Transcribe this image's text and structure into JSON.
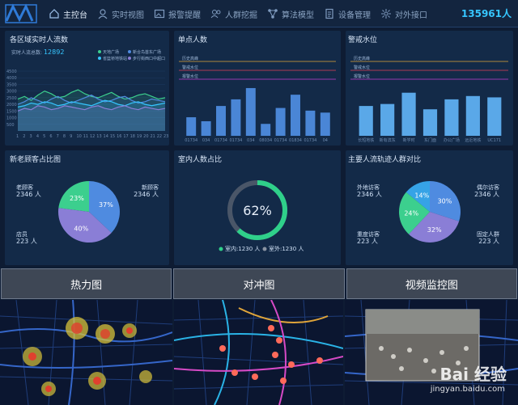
{
  "header": {
    "total_count": "135961人",
    "nav": [
      {
        "label": "主控台",
        "icon": "home-icon"
      },
      {
        "label": "实时视图",
        "icon": "user-icon"
      },
      {
        "label": "报警提醒",
        "icon": "image-icon"
      },
      {
        "label": "人群挖掘",
        "icon": "people-icon"
      },
      {
        "label": "算法模型",
        "icon": "network-icon"
      },
      {
        "label": "设备管理",
        "icon": "document-icon"
      },
      {
        "label": "对外接口",
        "icon": "api-icon"
      }
    ]
  },
  "panels": {
    "flow": {
      "title": "各区域实时人流数",
      "total_label": "实时人流总数:",
      "total_value": "12892",
      "legend": [
        "天地广场",
        "新合鸟首东广场",
        "省篮桥地铁站",
        "步行街西口中超口"
      ]
    },
    "single": {
      "title": "单点人数",
      "lines": [
        "历史高峰",
        "警戒水位",
        "报警水位"
      ]
    },
    "warn": {
      "title": "警戒水位",
      "lines": [
        "历史高峰",
        "警戒水位",
        "报警水位"
      ]
    },
    "newold": {
      "title": "新老顾客占比图",
      "labels": [
        {
          "name": "老顾客",
          "value": "2346 人"
        },
        {
          "name": "新顾客",
          "value": "2346 人"
        },
        {
          "name": "店员",
          "value": "223 人"
        }
      ]
    },
    "indoor": {
      "title": "室内人数占比",
      "percent": "62%",
      "legend": [
        "室内:1230 人",
        "室外:1230 人"
      ]
    },
    "trace": {
      "title": "主要人流轨迹人群对比",
      "labels": [
        {
          "name": "外地访客",
          "value": "2346 人"
        },
        {
          "name": "偶尔访客",
          "value": "2346 人"
        },
        {
          "name": "重度访客",
          "value": "223 人"
        },
        {
          "name": "固定人群",
          "value": "223 人"
        }
      ]
    }
  },
  "tabs": [
    "热力图",
    "对冲图",
    "视频监控图"
  ],
  "watermark": {
    "brand": "Bai 经验",
    "url": "jingyan.baidu.com"
  },
  "colors": {
    "accent": "#36c6ff",
    "bar": "#4a86d6",
    "green": "#3ccf8e",
    "purple": "#8a7ed6",
    "blue": "#4f8be0"
  },
  "chart_data": [
    {
      "type": "line",
      "title": "各区域实时人流数",
      "x": [
        1,
        2,
        3,
        4,
        5,
        6,
        7,
        8,
        9,
        10,
        11,
        12,
        13,
        14,
        15,
        16,
        17,
        18,
        19,
        20,
        21,
        22,
        23
      ],
      "ylim": [
        0,
        4500
      ],
      "yticks": [
        500,
        1000,
        1500,
        2000,
        2500,
        3000,
        3500,
        4000,
        4500
      ],
      "series": [
        {
          "name": "天地广场",
          "values": [
            2400,
            2600,
            2300,
            2700,
            3000,
            2800,
            2500,
            2600,
            2900,
            3100,
            2800,
            2600,
            2500,
            2700,
            2900,
            2600,
            2400,
            2500,
            2700,
            2800,
            2600,
            2400,
            2500
          ]
        },
        {
          "name": "新合鸟首东广场",
          "values": [
            2000,
            2200,
            2500,
            2300,
            2100,
            2400,
            2600,
            2300,
            2100,
            2300,
            2500,
            2700,
            2400,
            2200,
            2300,
            2500,
            2600,
            2300,
            2100,
            2200,
            2400,
            2300,
            2200
          ]
        },
        {
          "name": "省篮桥地铁站",
          "values": [
            1800,
            1900,
            2100,
            2000,
            2200,
            2100,
            1900,
            2000,
            2200,
            2100,
            2000,
            1900,
            2100,
            2300,
            2200,
            2000,
            1900,
            2100,
            2200,
            2000,
            1900,
            2000,
            2100
          ]
        },
        {
          "name": "步行街西口中超口",
          "values": [
            1500,
            1700,
            1600,
            1900,
            1800,
            1600,
            1700,
            1900,
            1800,
            1700,
            1600,
            1800,
            1900,
            1700,
            1600,
            1800,
            1900,
            1700,
            1600,
            1800,
            1700,
            1600,
            1700
          ]
        }
      ]
    },
    {
      "type": "bar",
      "title": "单点人数",
      "categories": [
        "01734",
        "034",
        "01734",
        "01734",
        "034",
        "08034",
        "01734",
        "01834",
        "01734",
        "04"
      ],
      "values": [
        28,
        22,
        45,
        55,
        72,
        18,
        42,
        62,
        38,
        35
      ],
      "ylim": [
        0,
        100
      ]
    },
    {
      "type": "bar",
      "title": "警戒水位",
      "categories": [
        "长短地铁",
        "新有滨东",
        "新学时",
        "东门面",
        "办公广场",
        "远近地铁",
        "UC171"
      ],
      "values": [
        45,
        48,
        65,
        40,
        55,
        60,
        58
      ],
      "ylim": [
        0,
        100
      ]
    },
    {
      "type": "pie",
      "title": "新老顾客占比图",
      "labels": [
        "23%",
        "37%",
        "40%"
      ],
      "values": [
        23,
        37,
        40
      ]
    },
    {
      "type": "pie",
      "title": "室内人数占比",
      "values": [
        62,
        38
      ],
      "labels": [
        "62%"
      ]
    },
    {
      "type": "pie",
      "title": "主要人流轨迹人群对比",
      "labels": [
        "14%",
        "30%",
        "32%",
        "24%"
      ],
      "values": [
        14,
        30,
        32,
        24
      ]
    }
  ]
}
